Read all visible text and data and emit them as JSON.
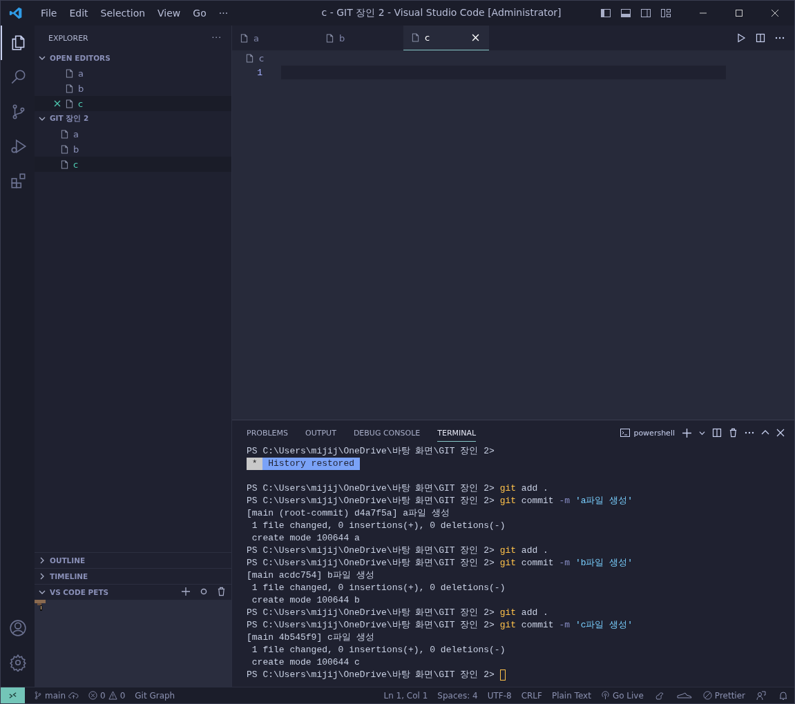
{
  "title_bar": {
    "menu": [
      "File",
      "Edit",
      "Selection",
      "View",
      "Go",
      "···"
    ],
    "title": "c - GIT 장인 2 - Visual Studio Code [Administrator]"
  },
  "activity_bar": [
    {
      "kind": "explorer",
      "selected": true
    },
    {
      "kind": "search",
      "selected": false
    },
    {
      "kind": "source-control",
      "selected": false
    },
    {
      "kind": "run-debug",
      "selected": false
    },
    {
      "kind": "extensions",
      "selected": false
    }
  ],
  "sidebar": {
    "title": "EXPLORER",
    "more": "···",
    "open_editors": {
      "title": "OPEN EDITORS",
      "expanded": true,
      "items": [
        {
          "label": "a",
          "selected": false
        },
        {
          "label": "b",
          "selected": false
        },
        {
          "label": "c",
          "selected": true
        }
      ]
    },
    "folder": {
      "title": "GIT 장인 2",
      "expanded": true,
      "items": [
        {
          "label": "a",
          "selected": false
        },
        {
          "label": "b",
          "selected": false
        },
        {
          "label": "c",
          "selected": true
        }
      ]
    },
    "bottom_sections": [
      {
        "title": "OUTLINE",
        "expanded": false
      },
      {
        "title": "TIMELINE",
        "expanded": false
      },
      {
        "title": "VS CODE PETS",
        "expanded": true
      }
    ]
  },
  "editor": {
    "tabs": [
      {
        "label": "a",
        "selected": false
      },
      {
        "label": "b",
        "selected": false
      },
      {
        "label": "c",
        "selected": true
      }
    ],
    "breadcrumb": "c",
    "line_numbers": [
      "1"
    ]
  },
  "panel": {
    "tabs": [
      {
        "label": "PROBLEMS",
        "selected": false
      },
      {
        "label": "OUTPUT",
        "selected": false
      },
      {
        "label": "DEBUG CONSOLE",
        "selected": false
      },
      {
        "label": "TERMINAL",
        "selected": true
      }
    ],
    "terminal_name": "powershell",
    "terminal_lines": [
      [
        {
          "kind": "text",
          "text": "PS C:\\Users\\mijij\\OneDrive\\바탕 화면\\GIT 장인 2>"
        }
      ],
      [
        {
          "kind": "badge",
          "text": " * "
        },
        {
          "kind": "badge-text",
          "text": " History restored "
        }
      ],
      {
        "kind": "blank"
      },
      [
        {
          "kind": "text",
          "text": "PS C:\\Users\\mijij\\OneDrive\\바탕 화면\\GIT 장인 2> "
        },
        {
          "kind": "git",
          "text": "git"
        },
        {
          "kind": "text",
          "text": " add ."
        }
      ],
      [
        {
          "kind": "text",
          "text": "PS C:\\Users\\mijij\\OneDrive\\바탕 화면\\GIT 장인 2> "
        },
        {
          "kind": "git",
          "text": "git"
        },
        {
          "kind": "text",
          "text": " commit "
        },
        {
          "kind": "flag",
          "text": "-m"
        },
        {
          "kind": "string",
          "text": " 'a파일 생성'"
        }
      ],
      [
        {
          "kind": "text",
          "text": "[main (root-commit) d4a7f5a] a파일 생성"
        }
      ],
      [
        {
          "kind": "text",
          "text": " 1 file changed, 0 insertions(+), 0 deletions(-)"
        }
      ],
      [
        {
          "kind": "text",
          "text": " create mode 100644 a"
        }
      ],
      [
        {
          "kind": "text",
          "text": "PS C:\\Users\\mijij\\OneDrive\\바탕 화면\\GIT 장인 2> "
        },
        {
          "kind": "git",
          "text": "git"
        },
        {
          "kind": "text",
          "text": " add ."
        }
      ],
      [
        {
          "kind": "text",
          "text": "PS C:\\Users\\mijij\\OneDrive\\바탕 화면\\GIT 장인 2> "
        },
        {
          "kind": "git",
          "text": "git"
        },
        {
          "kind": "text",
          "text": " commit "
        },
        {
          "kind": "flag",
          "text": "-m"
        },
        {
          "kind": "string",
          "text": " 'b파일 생성'"
        }
      ],
      [
        {
          "kind": "text",
          "text": "[main acdc754] b파일 생성"
        }
      ],
      [
        {
          "kind": "text",
          "text": " 1 file changed, 0 insertions(+), 0 deletions(-)"
        }
      ],
      [
        {
          "kind": "text",
          "text": " create mode 100644 b"
        }
      ],
      [
        {
          "kind": "text",
          "text": "PS C:\\Users\\mijij\\OneDrive\\바탕 화면\\GIT 장인 2> "
        },
        {
          "kind": "git",
          "text": "git"
        },
        {
          "kind": "text",
          "text": " add ."
        }
      ],
      [
        {
          "kind": "text",
          "text": "PS C:\\Users\\mijij\\OneDrive\\바탕 화면\\GIT 장인 2> "
        },
        {
          "kind": "git",
          "text": "git"
        },
        {
          "kind": "text",
          "text": " commit "
        },
        {
          "kind": "flag",
          "text": "-m"
        },
        {
          "kind": "string",
          "text": " 'c파일 생성'"
        }
      ],
      [
        {
          "kind": "text",
          "text": "[main 4b545f9] c파일 생성"
        }
      ],
      [
        {
          "kind": "text",
          "text": " 1 file changed, 0 insertions(+), 0 deletions(-)"
        }
      ],
      [
        {
          "kind": "text",
          "text": " create mode 100644 c"
        }
      ],
      [
        {
          "kind": "text",
          "text": "PS C:\\Users\\mijij\\OneDrive\\바탕 화면\\GIT 장인 2> "
        },
        {
          "kind": "cursor"
        }
      ]
    ]
  },
  "status_bar": {
    "branch": "main",
    "errors": "0",
    "warnings": "0",
    "git_graph": "Git Graph",
    "position": "Ln 1, Col 1",
    "spaces": "Spaces: 4",
    "encoding": "UTF-8",
    "eol": "CRLF",
    "language": "Plain Text",
    "go_live": "Go Live",
    "prettier": "Prettier"
  }
}
